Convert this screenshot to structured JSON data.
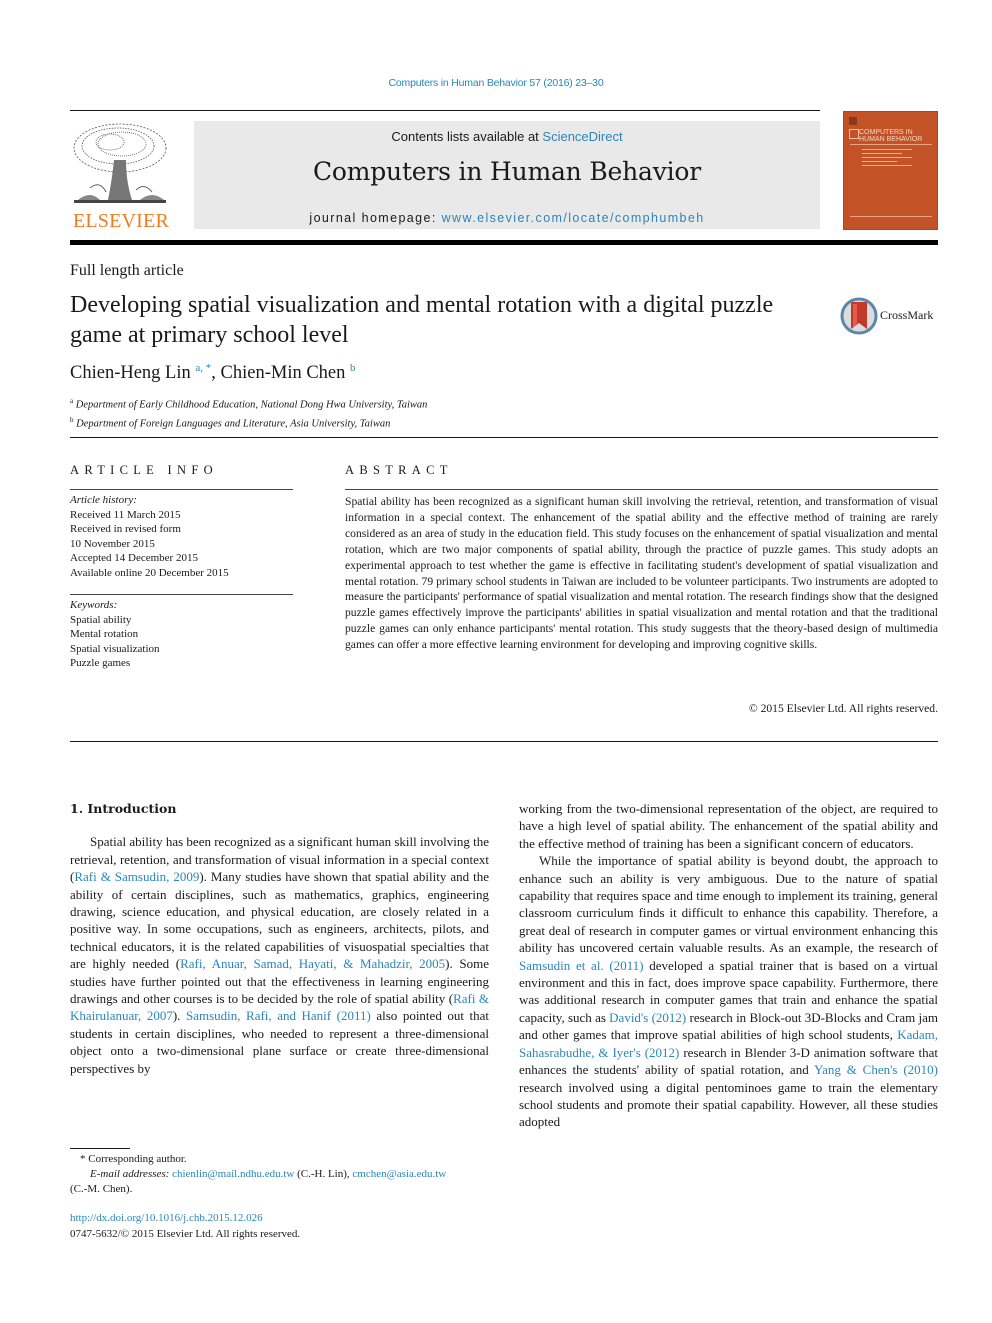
{
  "header": {
    "journal_reference": "Computers in Human Behavior 57 (2016) 23–30",
    "contents_prefix": "Contents lists available at ",
    "contents_link": "ScienceDirect",
    "journal_title": "Computers in Human Behavior",
    "homepage_prefix": "journal homepage: ",
    "homepage_link": "www.elsevier.com/locate/comphumbeh",
    "publisher_logo_text": "ELSEVIER",
    "publisher_logo_icon": "elsevier-tree-icon",
    "cover_title_line1": "COMPUTERS IN",
    "cover_title_line2": "HUMAN BEHAVIOR",
    "colors": {
      "link": "#2a86b8",
      "publisher_orange": "#f07a1c",
      "cover_orange": "#c35326",
      "masthead_gray": "#e9e9e9"
    }
  },
  "article": {
    "type": "Full length article",
    "title": "Developing spatial visualization and mental rotation with a digital puzzle game at primary school level",
    "crossmark_label": "CrossMark",
    "crossmark_icon": "crossmark-bookmark-icon",
    "authors": [
      {
        "name": "Chien-Heng Lin",
        "marks": "a, *"
      },
      {
        "name": "Chien-Min Chen",
        "marks": "b"
      }
    ],
    "author_separator": ", ",
    "affiliations": [
      {
        "mark": "a",
        "text": "Department of Early Childhood Education, National Dong Hwa University, Taiwan"
      },
      {
        "mark": "b",
        "text": "Department of Foreign Languages and Literature, Asia University, Taiwan"
      }
    ]
  },
  "article_info": {
    "heading": "ARTICLE INFO",
    "history_label": "Article history:",
    "history": [
      "Received 11 March 2015",
      "Received in revised form",
      "10 November 2015",
      "Accepted 14 December 2015",
      "Available online 20 December 2015"
    ],
    "keywords_label": "Keywords:",
    "keywords": [
      "Spatial ability",
      "Mental rotation",
      "Spatial visualization",
      "Puzzle games"
    ]
  },
  "abstract": {
    "heading": "ABSTRACT",
    "text": "Spatial ability has been recognized as a significant human skill involving the retrieval, retention, and transformation of visual information in a special context. The enhancement of the spatial ability and the effective method of training are rarely considered as an area of study in the education field. This study focuses on the enhancement of spatial visualization and mental rotation, which are two major compo­nents of spatial ability, through the practice of puzzle games. This study adopts an experimental approach to test whether the game is effective in facilitating student's development of spatial visuali­zation and mental rotation. 79 primary school students in Taiwan are included to be volunteer partici­pants. Two instruments are adopted to measure the participants' performance of spatial visualization and mental rotation. The research findings show that the designed puzzle games effectively improve the participants' abilities in spatial visualization and mental rotation and that the traditional puzzle games can only enhance participants' mental rotation. This study suggests that the theory-based design of multimedia games can offer a more effective learning environment for developing and improving cognitive skills.",
    "copyright": "© 2015 Elsevier Ltd. All rights reserved."
  },
  "body": {
    "section_heading": "1.  Introduction",
    "left_para1": [
      {
        "t": "Spatial ability has been recognized as a significant human skill involving the retrieval, retention, and transformation of visual in­formation in a special context ("
      },
      {
        "l": "Rafi & Samsudin, 2009"
      },
      {
        "t": "). Many studies have shown that spatial ability and the ability of certain disciplines, such as mathematics, graphics, engineering drawing, science education, and physical education, are closely related in a positive way. In some occupations, such as engineers, architects, pilots, and technical educators, it is the related capabilities of vi­suospatial specialties that are highly needed ("
      },
      {
        "l": "Rafi, Anuar, Samad, Hayati, & Mahadzir, 2005"
      },
      {
        "t": "). Some studies have further pointed out that the effectiveness in learning engineering drawings and other courses is to be decided by the role of spatial ability ("
      },
      {
        "l": "Rafi & Khairulanuar, 2007"
      },
      {
        "t": "). "
      },
      {
        "l": "Samsudin, Rafi, and Hanif (2011)"
      },
      {
        "t": " also pointed out that students in certain disciplines, who needed to represent a three-dimensional object onto a two-dimensional plane surface or create three-dimensional perspectives by"
      }
    ],
    "right_para1": "working from the two-dimensional representation of the object, are required to have a high level of spatial ability. The enhancement of the spatial ability and the effective method of training has been a significant concern of educators.",
    "right_para2": [
      {
        "t": "While the importance of spatial ability is beyond doubt, the approach to enhance such an ability is very ambiguous. Due to the nature of spatial capability that requires space and time enough to implement its training, general classroom curriculum finds it difficult to enhance this capability. Therefore, a great deal of research in computer games or virtual environment enhancing this ability has uncovered certain valuable results. As an example, the research of "
      },
      {
        "l": "Samsudin et al. (2011)"
      },
      {
        "t": " developed a spatial trainer that is based on a virtual environment and this in fact, does improve space capability. Furthermore, there was additional research in computer games that train and enhance the spatial capacity, such as "
      },
      {
        "l": "David's (2012)"
      },
      {
        "t": " research in Block-out 3D-Blocks and Cram jam and other games that improve spatial abilities of high school students, "
      },
      {
        "l": "Kadam, Sahasrabudhe, & Iyer's (2012)"
      },
      {
        "t": " research in Blender 3-D animation software that enhances the students' ability of spatial rotation, and "
      },
      {
        "l": "Yang & Chen's (2010)"
      },
      {
        "t": " research involved using a digital pentominoes game to train the elementary school students and promote their spatial capability. However, all these studies adopted"
      }
    ]
  },
  "footnotes": {
    "corresponding_mark": "*",
    "corresponding_text": "Corresponding author.",
    "email_label": "E-mail addresses:",
    "email1": "chienlin@mail.ndhu.edu.tw",
    "email1_owner": " (C.-H. Lin), ",
    "email2": "cmchen@asia.edu.tw",
    "email2_owner": "(C.-M. Chen).",
    "doi": "http://dx.doi.org/10.1016/j.chb.2015.12.026",
    "issn_copyright": "0747-5632/© 2015 Elsevier Ltd. All rights reserved."
  }
}
